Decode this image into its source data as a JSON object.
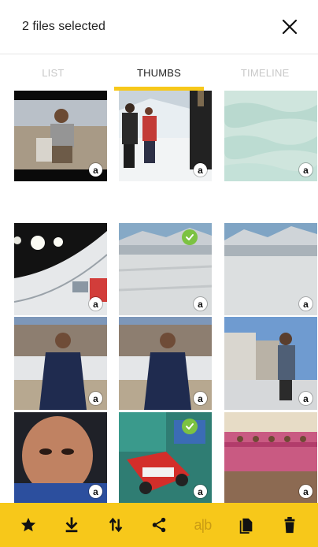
{
  "header": {
    "title": "2 files selected"
  },
  "tabs": [
    {
      "label": "LIST",
      "active": false
    },
    {
      "label": "THUMBS",
      "active": true
    },
    {
      "label": "TIMELINE",
      "active": false
    }
  ],
  "thumbnails": [
    {
      "badge": "a",
      "selected": false
    },
    {
      "badge": "a",
      "selected": false
    },
    {
      "badge": "a",
      "selected": false
    },
    {
      "badge": "a",
      "selected": false
    },
    {
      "badge": "a",
      "selected": true
    },
    {
      "badge": "a",
      "selected": false
    },
    {
      "badge": "a",
      "selected": false
    },
    {
      "badge": "a",
      "selected": false
    },
    {
      "badge": "a",
      "selected": false
    },
    {
      "badge": "a",
      "selected": false
    },
    {
      "badge": "a",
      "selected": true
    },
    {
      "badge": "a",
      "selected": false
    }
  ],
  "toolbar": {
    "items": [
      {
        "icon": "star-icon"
      },
      {
        "icon": "download-icon"
      },
      {
        "icon": "sort-icon"
      },
      {
        "icon": "share-icon"
      },
      {
        "icon": "compare-icon",
        "label": "a|b",
        "disabled": true
      },
      {
        "icon": "copy-icon"
      },
      {
        "icon": "trash-icon"
      }
    ]
  },
  "colors": {
    "accent": "#f7c81a",
    "check": "#7cc242"
  }
}
